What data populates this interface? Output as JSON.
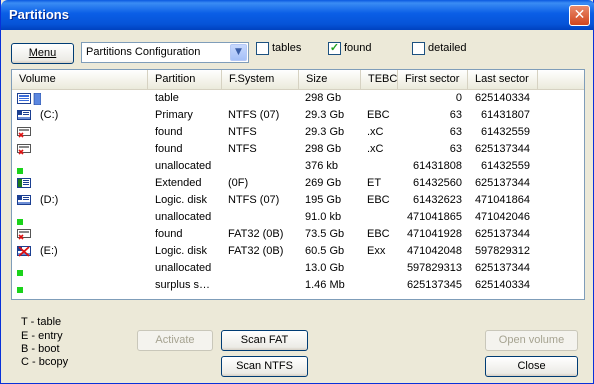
{
  "window": {
    "title": "Partitions",
    "close": "✕"
  },
  "toolbar": {
    "menu_label": "Menu",
    "config_value": "Partitions Configuration",
    "dropdown_arrow": "▼",
    "tables_label": "tables",
    "found_label": "found",
    "found_checked": "✓",
    "detailed_label": "detailed"
  },
  "columns": [
    "Volume",
    "Partition",
    "F.System",
    "Size",
    "TEBC",
    "First sector",
    "Last sector"
  ],
  "rows": [
    {
      "icon": "table-icon",
      "volume": "",
      "partition": "table",
      "fs": "",
      "size": "298 Gb",
      "tebc": "",
      "first": "0",
      "last": "625140334"
    },
    {
      "icon": "drive-icon",
      "volume": "(C:)",
      "partition": "Primary",
      "fs": "NTFS (07)",
      "size": "29.3 Gb",
      "tebc": "EBC",
      "first": "63",
      "last": "61431807"
    },
    {
      "icon": "found-partition-icon",
      "volume": "",
      "partition": "found",
      "fs": "NTFS",
      "size": "29.3 Gb",
      "tebc": ".xC",
      "first": "63",
      "last": "61432559"
    },
    {
      "icon": "found-partition-icon",
      "volume": "",
      "partition": "found",
      "fs": "NTFS",
      "size": "298 Gb",
      "tebc": ".xC",
      "first": "63",
      "last": "625137344"
    },
    {
      "icon": "unallocated-icon",
      "volume": "",
      "partition": "unallocated",
      "fs": "",
      "size": "376 kb",
      "tebc": "",
      "first": "61431808",
      "last": "61432559"
    },
    {
      "icon": "extended-icon",
      "volume": "",
      "partition": "Extended",
      "fs": "(0F)",
      "size": "269 Gb",
      "tebc": "ET",
      "first": "61432560",
      "last": "625137344"
    },
    {
      "icon": "drive-icon",
      "volume": "(D:)",
      "partition": "Logic. disk",
      "fs": "NTFS (07)",
      "size": "195 Gb",
      "tebc": "EBC",
      "first": "61432623",
      "last": "471041864"
    },
    {
      "icon": "unallocated-icon",
      "volume": "",
      "partition": "unallocated",
      "fs": "",
      "size": "91.0 kb",
      "tebc": "",
      "first": "471041865",
      "last": "471042046"
    },
    {
      "icon": "found-partition-icon",
      "volume": "",
      "partition": "found",
      "fs": "FAT32 (0B)",
      "size": "73.5 Gb",
      "tebc": "EBC",
      "first": "471041928",
      "last": "625137344"
    },
    {
      "icon": "error-drive-icon",
      "volume": "(E:)",
      "partition": "Logic. disk",
      "fs": "FAT32 (0B)",
      "size": "60.5 Gb",
      "tebc": "Exx",
      "first": "471042048",
      "last": "597829312"
    },
    {
      "icon": "unallocated-icon",
      "volume": "",
      "partition": "unallocated",
      "fs": "",
      "size": "13.0 Gb",
      "tebc": "",
      "first": "597829313",
      "last": "625137344"
    },
    {
      "icon": "unallocated-icon",
      "volume": "",
      "partition": "surplus s…",
      "fs": "",
      "size": "1.46 Mb",
      "tebc": "",
      "first": "625137345",
      "last": "625140334"
    }
  ],
  "legend": [
    "T - table",
    "E - entry",
    "B - boot",
    "C - bcopy"
  ],
  "buttons": {
    "activate": "Activate",
    "scan_fat": "Scan FAT",
    "scan_ntfs": "Scan NTFS",
    "open_volume": "Open volume",
    "close": "Close"
  }
}
